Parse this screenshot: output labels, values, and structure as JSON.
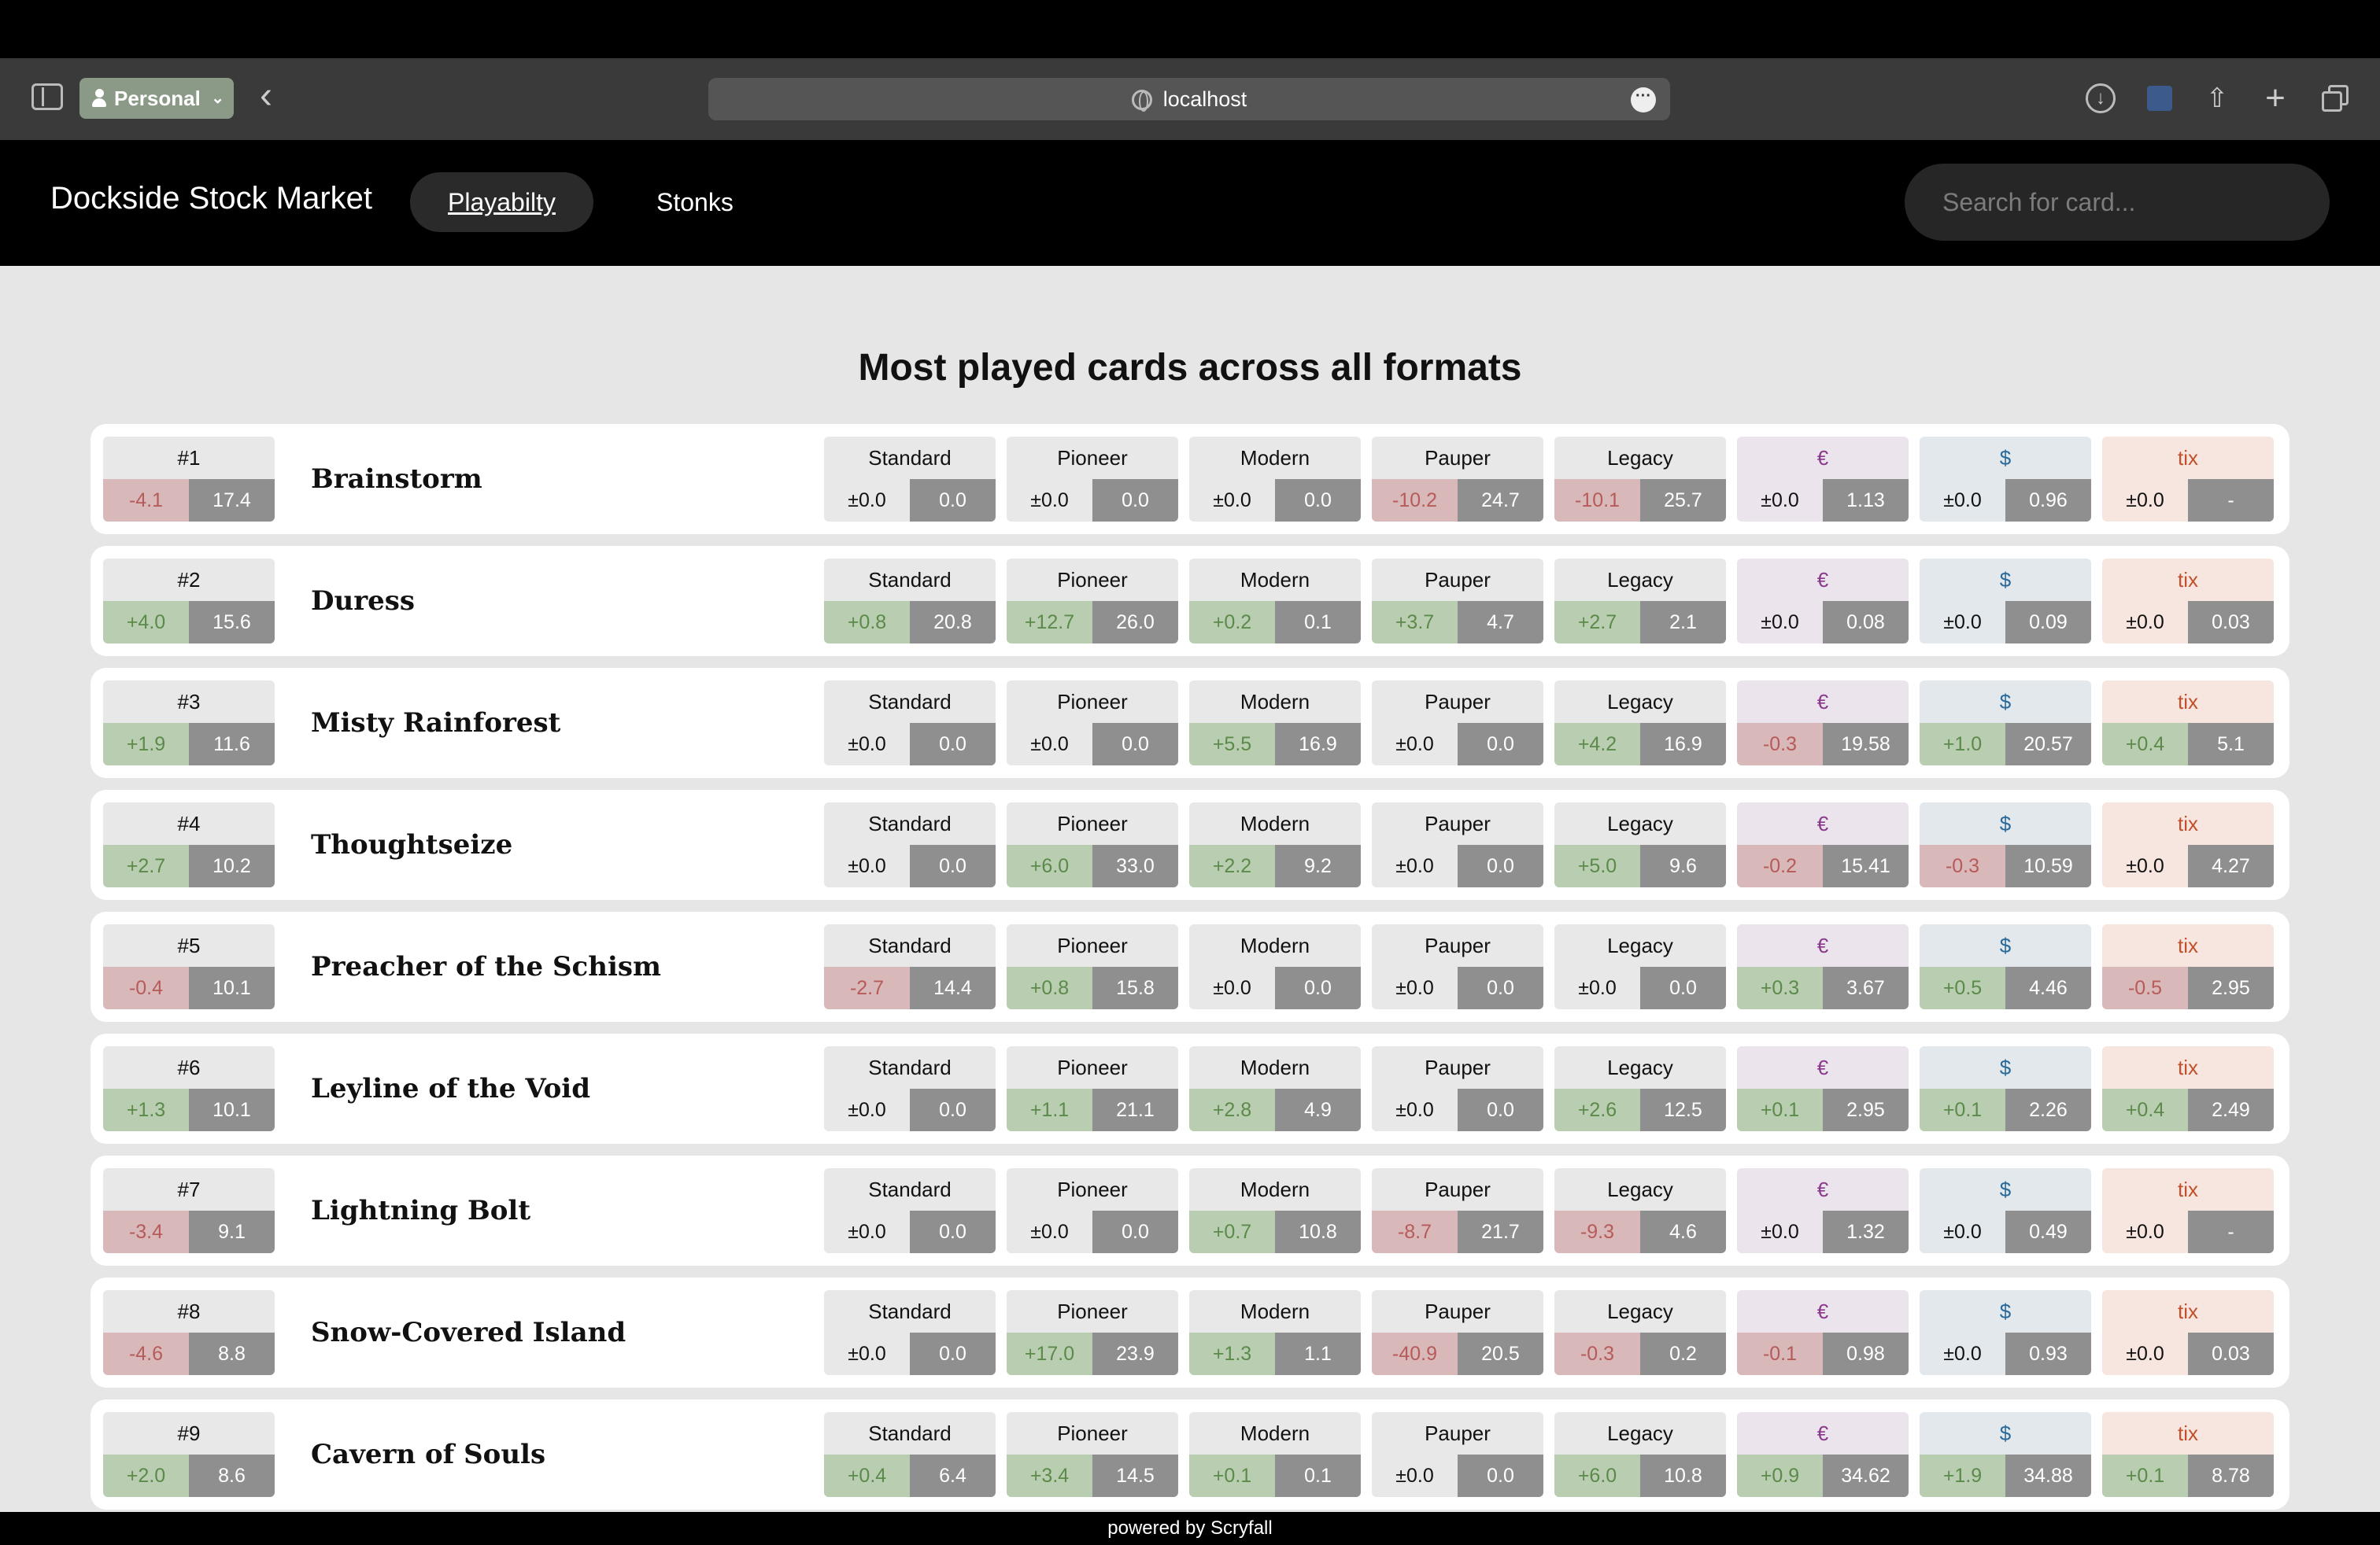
{
  "browser": {
    "profile_label": "Personal",
    "url": "localhost"
  },
  "nav": {
    "brand": "Dockside Stock Market",
    "links": [
      "Playabilty",
      "Stonks"
    ],
    "search_placeholder": "Search for card..."
  },
  "heading": "Most played cards across all formats",
  "columns": [
    "Standard",
    "Pioneer",
    "Modern",
    "Pauper",
    "Legacy",
    "€",
    "$",
    "tix"
  ],
  "cards": [
    {
      "rank": "#1",
      "rank_delta": "-4.1",
      "rank_value": "17.4",
      "name": "Brainstorm",
      "stats": [
        [
          "±0.0",
          "0.0"
        ],
        [
          "±0.0",
          "0.0"
        ],
        [
          "±0.0",
          "0.0"
        ],
        [
          "-10.2",
          "24.7"
        ],
        [
          "-10.1",
          "25.7"
        ],
        [
          "±0.0",
          "1.13"
        ],
        [
          "±0.0",
          "0.96"
        ],
        [
          "±0.0",
          "-"
        ]
      ]
    },
    {
      "rank": "#2",
      "rank_delta": "+4.0",
      "rank_value": "15.6",
      "name": "Duress",
      "stats": [
        [
          "+0.8",
          "20.8"
        ],
        [
          "+12.7",
          "26.0"
        ],
        [
          "+0.2",
          "0.1"
        ],
        [
          "+3.7",
          "4.7"
        ],
        [
          "+2.7",
          "2.1"
        ],
        [
          "±0.0",
          "0.08"
        ],
        [
          "±0.0",
          "0.09"
        ],
        [
          "±0.0",
          "0.03"
        ]
      ]
    },
    {
      "rank": "#3",
      "rank_delta": "+1.9",
      "rank_value": "11.6",
      "name": "Misty Rainforest",
      "stats": [
        [
          "±0.0",
          "0.0"
        ],
        [
          "±0.0",
          "0.0"
        ],
        [
          "+5.5",
          "16.9"
        ],
        [
          "±0.0",
          "0.0"
        ],
        [
          "+4.2",
          "16.9"
        ],
        [
          "-0.3",
          "19.58"
        ],
        [
          "+1.0",
          "20.57"
        ],
        [
          "+0.4",
          "5.1"
        ]
      ]
    },
    {
      "rank": "#4",
      "rank_delta": "+2.7",
      "rank_value": "10.2",
      "name": "Thoughtseize",
      "stats": [
        [
          "±0.0",
          "0.0"
        ],
        [
          "+6.0",
          "33.0"
        ],
        [
          "+2.2",
          "9.2"
        ],
        [
          "±0.0",
          "0.0"
        ],
        [
          "+5.0",
          "9.6"
        ],
        [
          "-0.2",
          "15.41"
        ],
        [
          "-0.3",
          "10.59"
        ],
        [
          "±0.0",
          "4.27"
        ]
      ]
    },
    {
      "rank": "#5",
      "rank_delta": "-0.4",
      "rank_value": "10.1",
      "name": "Preacher of the Schism",
      "stats": [
        [
          "-2.7",
          "14.4"
        ],
        [
          "+0.8",
          "15.8"
        ],
        [
          "±0.0",
          "0.0"
        ],
        [
          "±0.0",
          "0.0"
        ],
        [
          "±0.0",
          "0.0"
        ],
        [
          "+0.3",
          "3.67"
        ],
        [
          "+0.5",
          "4.46"
        ],
        [
          "-0.5",
          "2.95"
        ]
      ]
    },
    {
      "rank": "#6",
      "rank_delta": "+1.3",
      "rank_value": "10.1",
      "name": "Leyline of the Void",
      "stats": [
        [
          "±0.0",
          "0.0"
        ],
        [
          "+1.1",
          "21.1"
        ],
        [
          "+2.8",
          "4.9"
        ],
        [
          "±0.0",
          "0.0"
        ],
        [
          "+2.6",
          "12.5"
        ],
        [
          "+0.1",
          "2.95"
        ],
        [
          "+0.1",
          "2.26"
        ],
        [
          "+0.4",
          "2.49"
        ]
      ]
    },
    {
      "rank": "#7",
      "rank_delta": "-3.4",
      "rank_value": "9.1",
      "name": "Lightning Bolt",
      "stats": [
        [
          "±0.0",
          "0.0"
        ],
        [
          "±0.0",
          "0.0"
        ],
        [
          "+0.7",
          "10.8"
        ],
        [
          "-8.7",
          "21.7"
        ],
        [
          "-9.3",
          "4.6"
        ],
        [
          "±0.0",
          "1.32"
        ],
        [
          "±0.0",
          "0.49"
        ],
        [
          "±0.0",
          "-"
        ]
      ]
    },
    {
      "rank": "#8",
      "rank_delta": "-4.6",
      "rank_value": "8.8",
      "name": "Snow-Covered Island",
      "stats": [
        [
          "±0.0",
          "0.0"
        ],
        [
          "+17.0",
          "23.9"
        ],
        [
          "+1.3",
          "1.1"
        ],
        [
          "-40.9",
          "20.5"
        ],
        [
          "-0.3",
          "0.2"
        ],
        [
          "-0.1",
          "0.98"
        ],
        [
          "±0.0",
          "0.93"
        ],
        [
          "±0.0",
          "0.03"
        ]
      ]
    },
    {
      "rank": "#9",
      "rank_delta": "+2.0",
      "rank_value": "8.6",
      "name": "Cavern of Souls",
      "stats": [
        [
          "+0.4",
          "6.4"
        ],
        [
          "+3.4",
          "14.5"
        ],
        [
          "+0.1",
          "0.1"
        ],
        [
          "±0.0",
          "0.0"
        ],
        [
          "+6.0",
          "10.8"
        ],
        [
          "+0.9",
          "34.62"
        ],
        [
          "+1.9",
          "34.88"
        ],
        [
          "+0.1",
          "8.78"
        ]
      ]
    }
  ],
  "footer": "powered by Scryfall"
}
